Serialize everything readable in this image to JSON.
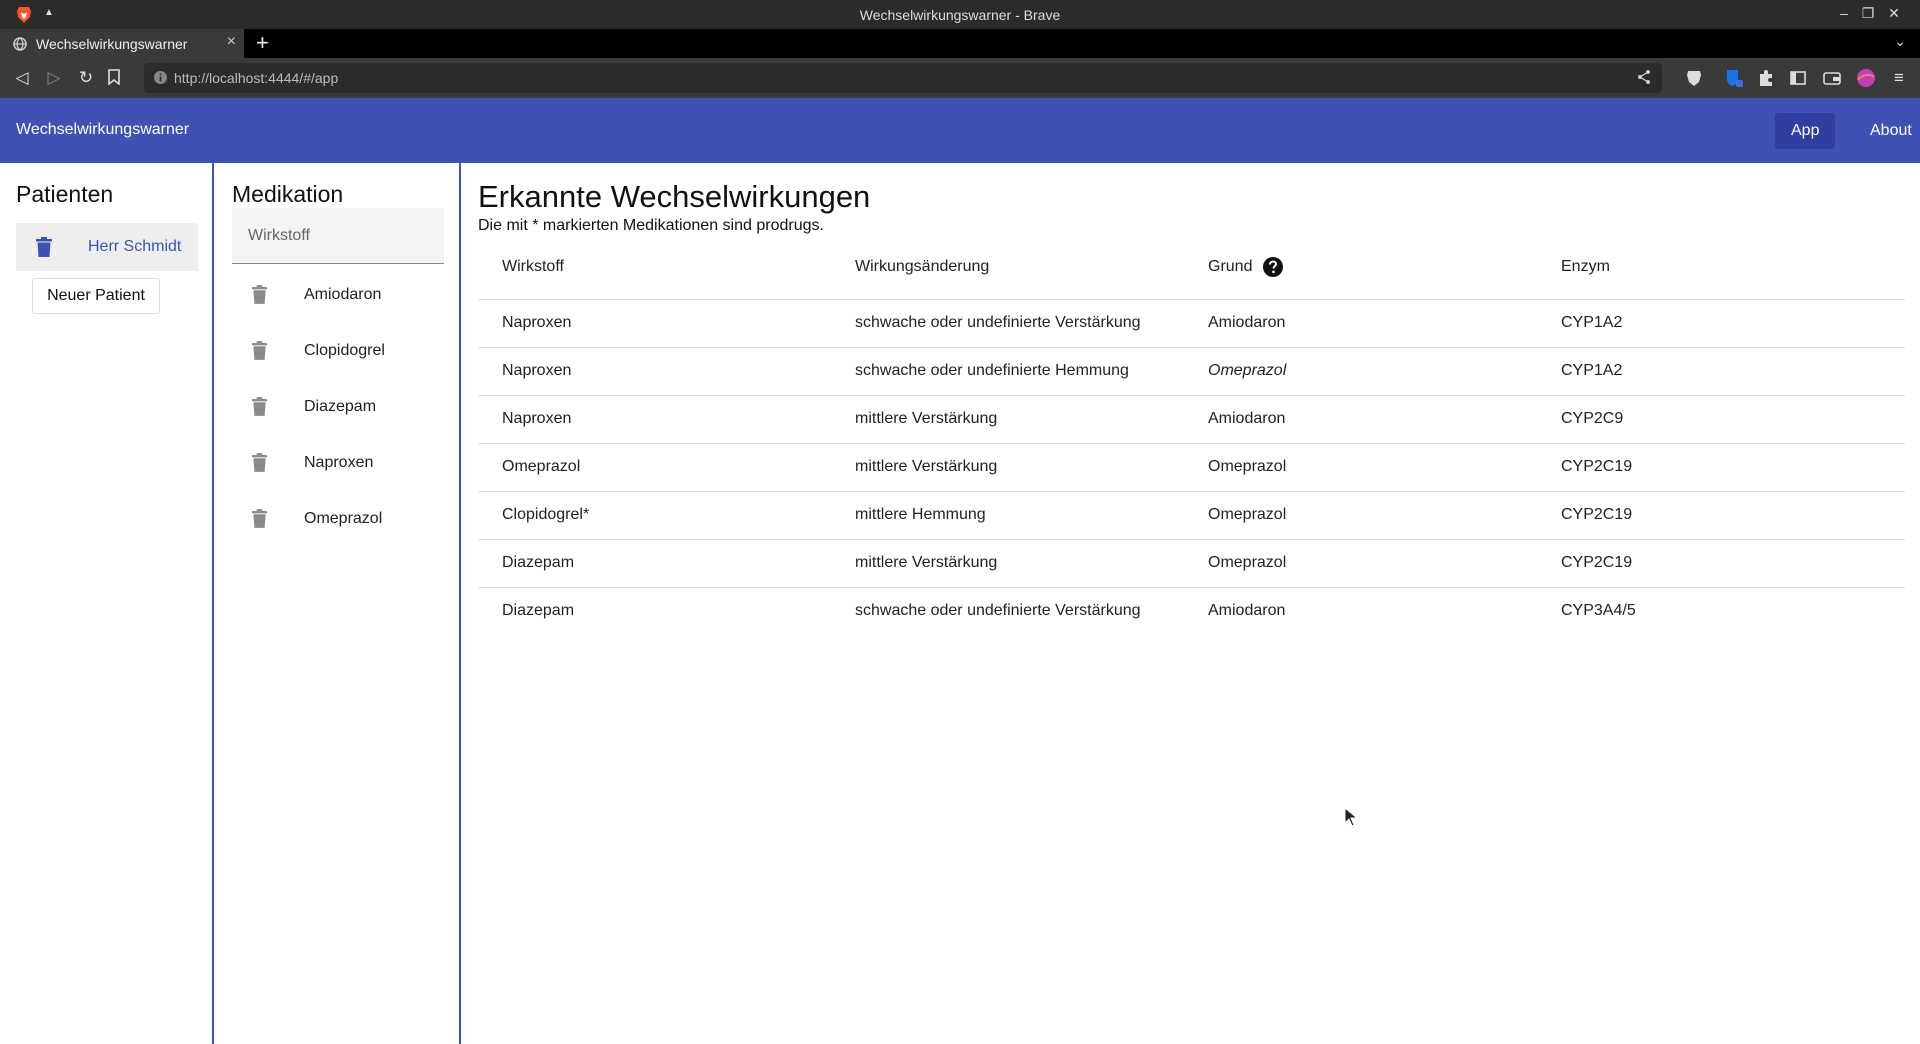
{
  "browser": {
    "window_title": "Wechselwirkungswarner - Brave",
    "tab_title": "Wechselwirkungswarner",
    "url": "http://localhost:4444/#/app"
  },
  "appbar": {
    "title": "Wechselwirkungswarner",
    "nav_app": "App",
    "nav_about": "About"
  },
  "patients": {
    "heading": "Patienten",
    "items": [
      {
        "name": "Herr Schmidt"
      }
    ],
    "new_button": "Neuer Patient"
  },
  "medication": {
    "heading": "Medikation",
    "input_placeholder": "Wirkstoff",
    "input_value": "",
    "items": [
      {
        "name": "Amiodaron"
      },
      {
        "name": "Clopidogrel"
      },
      {
        "name": "Diazepam"
      },
      {
        "name": "Naproxen"
      },
      {
        "name": "Omeprazol"
      }
    ]
  },
  "interactions": {
    "heading": "Erkannte Wechselwirkungen",
    "note": "Die mit * markierten Medikationen sind prodrugs.",
    "columns": {
      "wirkstoff": "Wirkstoff",
      "aenderung": "Wirkungsänderung",
      "grund": "Grund",
      "enzym": "Enzym"
    },
    "rows": [
      {
        "wirkstoff": "Naproxen",
        "aenderung": "schwache oder undefinierte Verstärkung",
        "grund": "Amiodaron",
        "enzym": "CYP1A2",
        "grund_italic": false
      },
      {
        "wirkstoff": "Naproxen",
        "aenderung": "schwache oder undefinierte Hemmung",
        "grund": "Omeprazol",
        "enzym": "CYP1A2",
        "grund_italic": true
      },
      {
        "wirkstoff": "Naproxen",
        "aenderung": "mittlere Verstärkung",
        "grund": "Amiodaron",
        "enzym": "CYP2C9",
        "grund_italic": false
      },
      {
        "wirkstoff": "Omeprazol",
        "aenderung": "mittlere Verstärkung",
        "grund": "Omeprazol",
        "enzym": "CYP2C19",
        "grund_italic": false
      },
      {
        "wirkstoff": "Clopidogrel*",
        "aenderung": "mittlere Hemmung",
        "grund": "Omeprazol",
        "enzym": "CYP2C19",
        "grund_italic": false
      },
      {
        "wirkstoff": "Diazepam",
        "aenderung": "mittlere Verstärkung",
        "grund": "Omeprazol",
        "enzym": "CYP2C19",
        "grund_italic": false
      },
      {
        "wirkstoff": "Diazepam",
        "aenderung": "schwache oder undefinierte Verstärkung",
        "grund": "Amiodaron",
        "enzym": "CYP3A4/5",
        "grund_italic": false
      }
    ]
  },
  "colors": {
    "primary": "#3f51b5",
    "primary_dark": "#303f9f",
    "browser_dark": "#2b2b2b"
  },
  "icons": {
    "delete": "trash-icon",
    "help": "help-circle-icon"
  }
}
